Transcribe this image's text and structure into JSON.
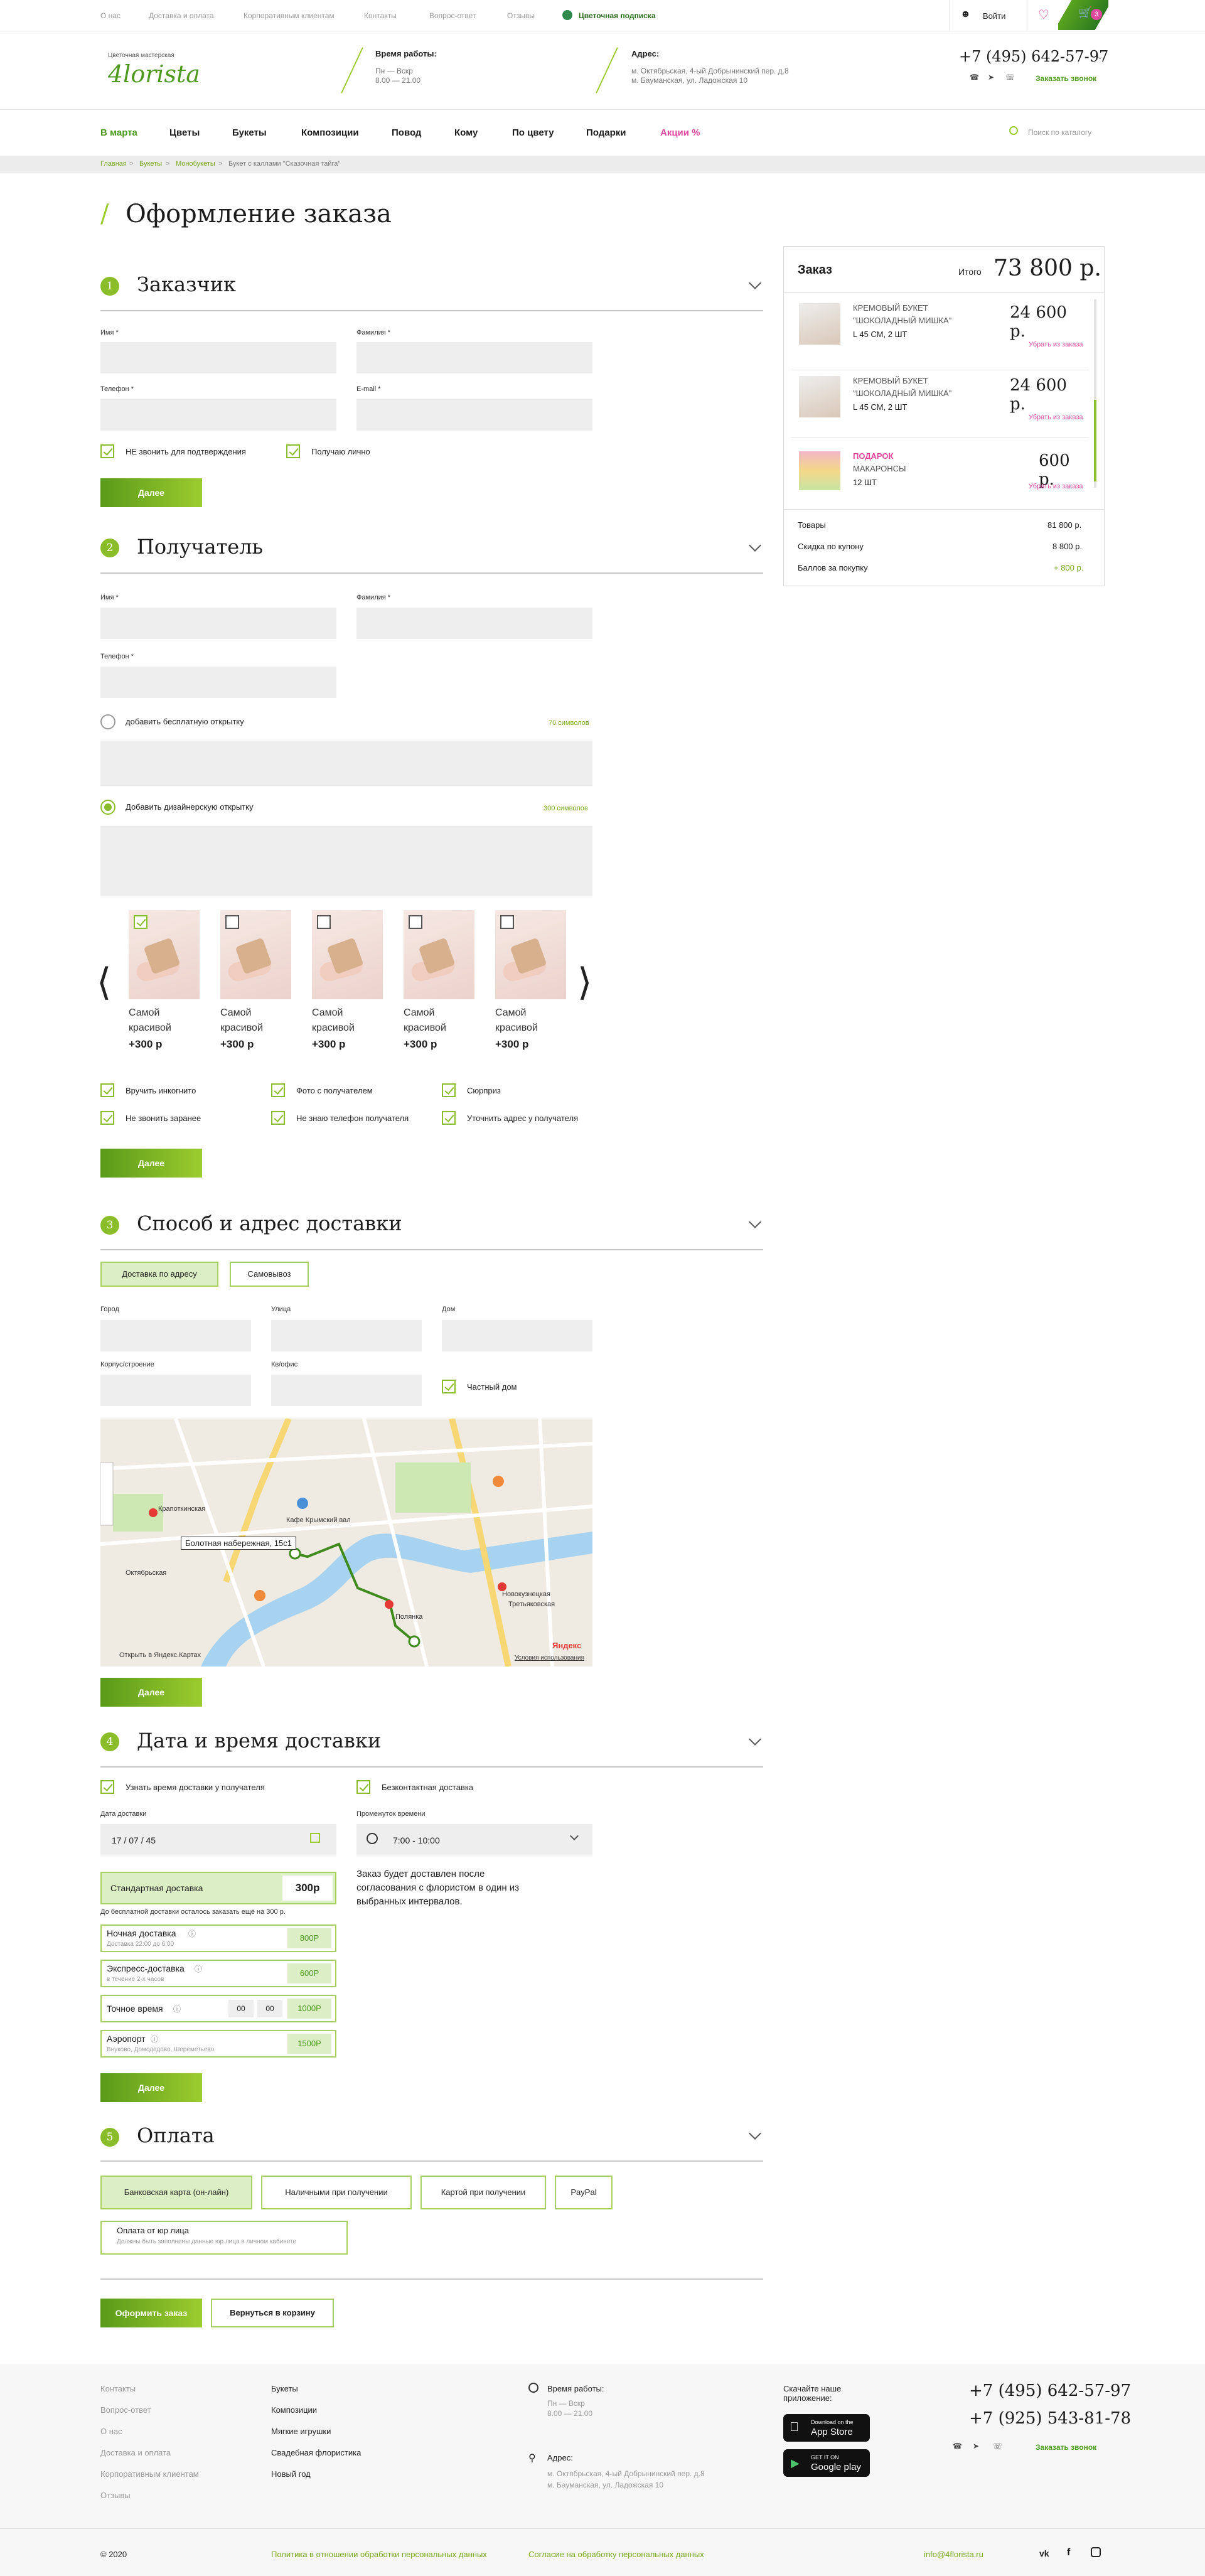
{
  "topbar": {
    "links": [
      "О нас",
      "Доставка и оплата",
      "Корпоративным клиентам",
      "Контакты",
      "Вопрос-ответ",
      "Отзывы"
    ],
    "subscribe": "Цветочная подписка",
    "login": "Войти",
    "cart_count": "3"
  },
  "header": {
    "logo_small": "Цветочная мастерская",
    "logo": "4lorista",
    "hours_label": "Время работы:",
    "hours_value": "Пн — Вскр",
    "hours_time": "8.00 — 21.00",
    "address_label": "Адрес:",
    "address_1": "м. Октябрьская, 4-ый Добрынинский пер. д.8",
    "address_2": "м. Бауманская, ул. Ладожская 10",
    "phone": "+7 (495) 642-57-97",
    "callback": "Заказать звонок"
  },
  "nav": {
    "items": [
      "В марта",
      "Цветы",
      "Букеты",
      "Композиции",
      "Повод",
      "Кому",
      "По цвету",
      "Подарки",
      "Акции %"
    ],
    "search_placeholder": "Поиск по каталогу"
  },
  "breadcrumbs": [
    "Главная",
    "Букеты",
    "Монобукеты",
    "Букет с каллами \"Сказочная тайга\""
  ],
  "page_title": "Оформление заказа",
  "s1": {
    "num": "1",
    "title": "Заказчик",
    "name": "Имя *",
    "surname": "Фамилия *",
    "phone": "Телефон *",
    "email": "E-mail *",
    "cb1": "НЕ звонить для подтверждения",
    "cb2": "Получаю лично",
    "next": "Далее"
  },
  "s2": {
    "num": "2",
    "title": "Получатель",
    "name": "Имя *",
    "surname": "Фамилия *",
    "phone": "Телефон *",
    "free_card": "добавить бесплатную открытку",
    "free_count": "70 символов",
    "design_card": "Добавить дизайнерскую открытку",
    "design_count": "300 символов",
    "cards": [
      {
        "title": "Самой красивой",
        "price": "+300 р"
      },
      {
        "title": "Самой красивой",
        "price": "+300 р"
      },
      {
        "title": "Самой красивой",
        "price": "+300 р"
      },
      {
        "title": "Самой красивой",
        "price": "+300 р"
      },
      {
        "title": "Самой красивой",
        "price": "+300 р"
      }
    ],
    "opts": [
      "Вручить инкогнито",
      "Фото с получателем",
      "Сюрприз",
      "Не звонить заранее",
      "Не знаю телефон получателя",
      "Уточнить адрес у получателя"
    ],
    "next": "Далее"
  },
  "s3": {
    "num": "3",
    "title": "Способ и адрес доставки",
    "tab1": "Доставка по адресу",
    "tab2": "Самовывоз",
    "city": "Город",
    "street": "Улица",
    "house": "Дом",
    "building": "Корпус/строение",
    "phone_code": "Кв/офис",
    "private": "Частный дом",
    "map_pin": "Болотная набережная, 15с1",
    "map_open": "Открыть в Яндекс.Картах",
    "map_terms": "Условия использования",
    "map_brand": "Яндекс",
    "map_labels": [
      "Крапоткинская",
      "Кафе Крымский вал",
      "Третьяковская",
      "Полянка",
      "Новокузнецкая",
      "Октябрьская"
    ],
    "next": "Далее"
  },
  "s4": {
    "num": "4",
    "title": "Дата и время доставки",
    "cb1": "Узнать время доставки у получателя",
    "cb2": "Безконтактная доставка",
    "date_label": "Дата доставки",
    "date": "17 / 07 / 45",
    "time_label": "Промежуток времени",
    "time": "7:00 - 10:00",
    "note": "Заказ будет доставлен после согласования с флористом в один из выбранных интервалов.",
    "standard": "Стандартная доставка",
    "standard_price": "300р",
    "free_note": "До бесплатной доставки осталось заказать ещё на 300 р.",
    "night": "Ночная доставка",
    "night_sub": "Доставка 22:00 до 6:00",
    "night_price": "800Р",
    "express": "Экспресс-доставка",
    "express_sub": "в течение 2-х часов",
    "express_price": "600Р",
    "exact": "Точное время",
    "exact_h": "00",
    "exact_m": "00",
    "exact_price": "1000Р",
    "airport": "Аэропорт",
    "airport_sub": "Внуково, Домодедово, Шереметьево",
    "airport_price": "1500Р",
    "next": "Далее"
  },
  "s5": {
    "num": "5",
    "title": "Оплата",
    "p1": "Банковская карта (он-лайн)",
    "p2": "Наличными при получении",
    "p3": "Картой при получении",
    "p4": "PayPal",
    "p5": "Оплата от юр лица",
    "p5_sub": "Должны быть заполнены данные юр лица в личном кабинете",
    "submit": "Оформить заказ",
    "back": "Вернуться в корзину"
  },
  "summary": {
    "title": "Заказ",
    "total_label": "Итого",
    "total": "73 800 р.",
    "items": [
      {
        "name1": "КРЕМОВЫЙ БУКЕТ",
        "name2": "\"ШОКОЛАДНЫЙ МИШКА\"",
        "meta": "L 45 СМ, 2 ШТ",
        "price": "24 600 р.",
        "remove": "Убрать из заказа"
      },
      {
        "name1": "КРЕМОВЫЙ БУКЕТ",
        "name2": "\"ШОКОЛАДНЫЙ МИШКА\"",
        "meta": "L 45 СМ, 2 ШТ",
        "price": "24 600 р.",
        "remove": "Убрать из заказа"
      },
      {
        "name1": "ПОДАРОК",
        "name2": "МАКАРОНСЫ",
        "meta": "12 ШТ",
        "price": "600 р.",
        "remove": "Убрать из заказа"
      }
    ],
    "goods_label": "Товары",
    "goods": "81 800 р.",
    "coupon_label": "Скидка по купону",
    "coupon": "8 800 р.",
    "points_label": "Баллов за покупку",
    "points": "+ 800 р."
  },
  "footer": {
    "col1": [
      "Контакты",
      "Вопрос-ответ",
      "О нас",
      "Доставка и оплата",
      "Корпоративным клиентам",
      "Отзывы"
    ],
    "col2": [
      "Букеты",
      "Композиции",
      "Мягкие игрушки",
      "Свадебная флористика",
      "Новый год"
    ],
    "hours_label": "Время работы:",
    "hours_value": "Пн — Вскр",
    "hours_time": "8.00 — 21.00",
    "address_label": "Адрес:",
    "address_1": "м. Октябрьская, 4-ый Добрынинский пер. д.8",
    "address_2": "м. Бауманская, ул. Ладожская 10",
    "app_label": "Скачайте наше приложение:",
    "appstore_small": "Download on the",
    "appstore": "App Store",
    "gplay_small": "GET IT ON",
    "gplay": "Google play",
    "phone1": "+7 (495) 642-57-97",
    "phone2": "+7 (925) 543-81-78",
    "callback": "Заказать звонок",
    "copy": "© 2020",
    "policy": "Политика в отношении обработки персональных данных",
    "consent": "Согласие на обработку персональных данных",
    "email": "info@4florista.ru"
  }
}
